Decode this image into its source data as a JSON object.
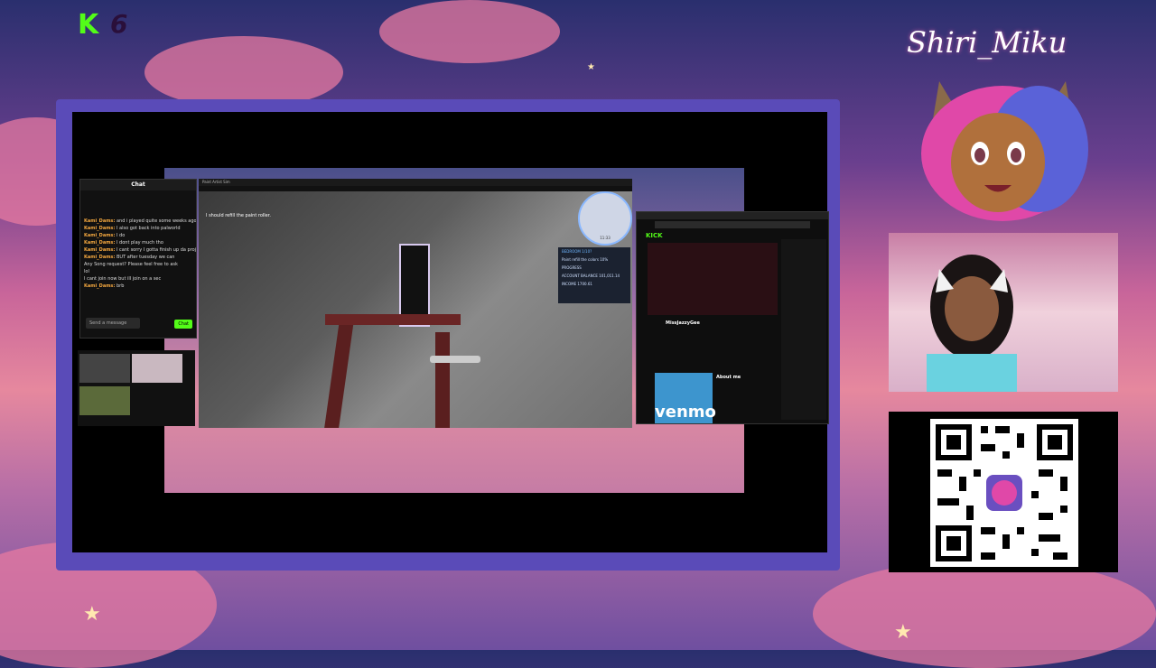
{
  "overlay": {
    "channel_logo_text": "K",
    "channel_number": "6",
    "streamer_name": "Shiri_Miku"
  },
  "chat_window": {
    "title": "Chat",
    "messages": [
      {
        "user": "Kami_Dams:",
        "text": "and i played quite some weeks ago"
      },
      {
        "user": "Kami_Dams:",
        "text": "I also got back into palworld"
      },
      {
        "user": "Kami_Dams:",
        "text": "I do"
      },
      {
        "user": "Kami_Dams:",
        "text": "I dont play much tho"
      },
      {
        "user": "Kami_Dams:",
        "text": "I cant sorry I gotta finish up da proj"
      },
      {
        "user": "Kami_Dams:",
        "text": "BUT after tuesday we can"
      },
      {
        "user": "",
        "text": "Any Song request? Please feel free to ask"
      },
      {
        "user": "",
        "text": "lol"
      },
      {
        "user": "",
        "text": "I cant join now but ill join on a sec"
      },
      {
        "user": "Kami_Dams:",
        "text": "brb"
      }
    ],
    "input_placeholder": "Send a message",
    "send_label": "Chat"
  },
  "game": {
    "window_title": "Paint Artist Sim",
    "status_text": "I should refill the paint roller.",
    "panel": {
      "title": "BEDROOM 1/10?",
      "task": "Paint refill the colors 10%",
      "progress_label": "PROGRESS",
      "balance_label": "ACCOUNT BALANCE",
      "balance_value": "101,011.14",
      "income_label": "INCOME",
      "income_value": "1700.61"
    },
    "minimap_time": "11:33"
  },
  "browser": {
    "site_logo": "KICK",
    "channel_name": "MissJazzyGee",
    "about_label": "About me",
    "venmo_label": "venmo"
  },
  "colors": {
    "kick_green": "#53fc18",
    "frame_purple": "#5a4bb8",
    "venmo_blue": "#3d95ce"
  }
}
